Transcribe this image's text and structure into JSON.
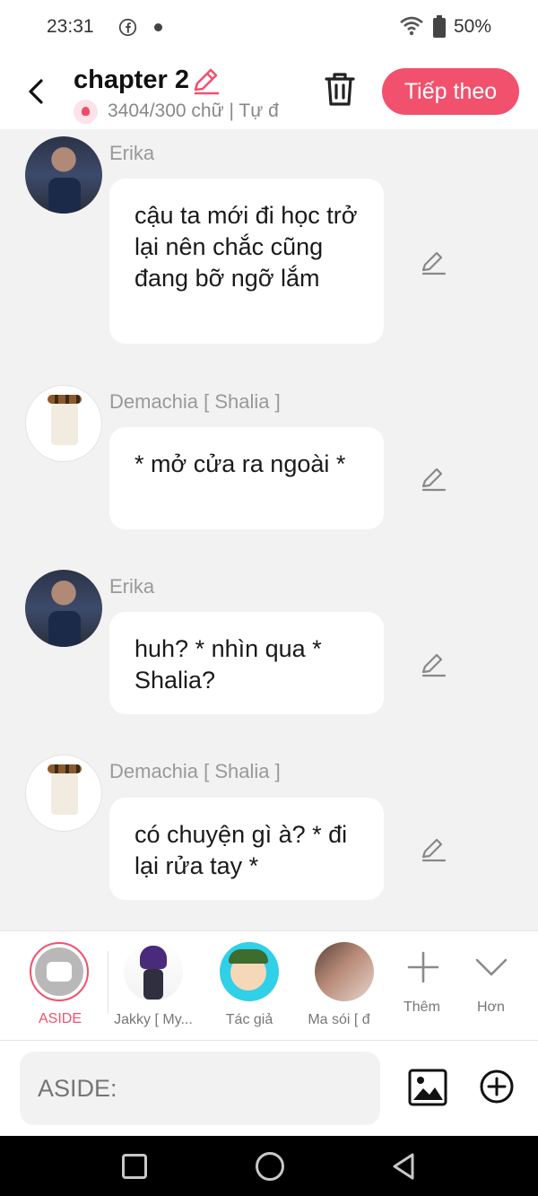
{
  "status_bar": {
    "time": "23:31",
    "battery": "50%",
    "icons": [
      "facebook-icon",
      "notification-dot",
      "wifi-icon",
      "battery-icon"
    ]
  },
  "header": {
    "title": "chapter 2",
    "meta": "3404/300 chữ | Tự đ",
    "next_button": "Tiếp theo",
    "accent_color": "#f2516d",
    "icons": [
      "back-icon",
      "edit-icon",
      "trash-icon"
    ]
  },
  "messages": [
    {
      "sender": "Erika",
      "text": "cậu ta mới đi học trở lại nên chắc cũng đang bỡ ngỡ lắm"
    },
    {
      "sender": "Demachia [ Shalia ]",
      "text": "* mở cửa ra ngoài *"
    },
    {
      "sender": "Erika",
      "text": "huh? * nhìn qua * Shalia?"
    },
    {
      "sender": "Demachia [ Shalia ]",
      "text": "có chuyện gì à? * đi lại rửa tay *"
    }
  ],
  "characters": {
    "aside_label": "ASIDE",
    "items": [
      {
        "label": "Jakky [ My..."
      },
      {
        "label": "Tác giả"
      },
      {
        "label": "Ma sói [ đ"
      }
    ],
    "add_label": "Thêm",
    "more_label": "Hơn"
  },
  "input": {
    "placeholder": "ASIDE:",
    "icons": [
      "image-icon",
      "add-circle-icon"
    ]
  },
  "nav_bar": {
    "icons": [
      "recents-icon",
      "home-icon",
      "back-triangle-icon"
    ]
  }
}
